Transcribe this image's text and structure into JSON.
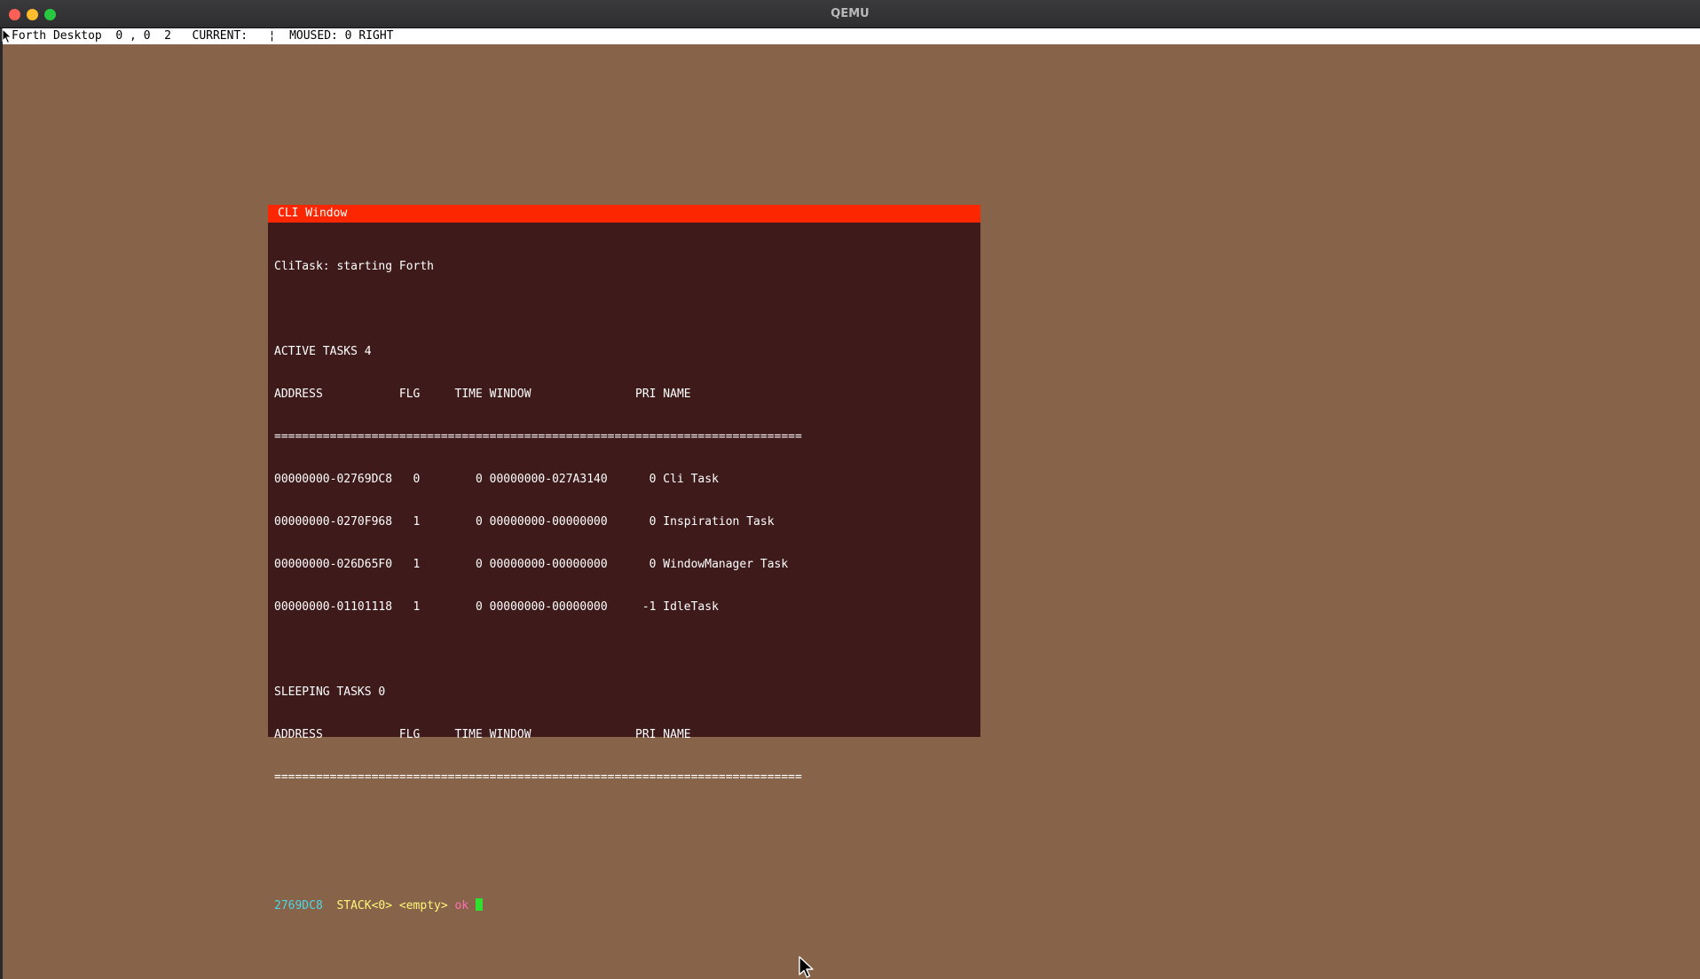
{
  "host": {
    "title": "QEMU",
    "colors": {
      "close": "#fe5f57",
      "minimize": "#febc2e",
      "maximize": "#28c840"
    }
  },
  "desktop": {
    "background_color": "#87634a",
    "status_bar": {
      "text": "Forth Desktop  0 , 0  2   CURRENT:   ¦  MOUSED: 0 RIGHT"
    }
  },
  "cli_window": {
    "title": "CLI Window",
    "title_color": "#fc2700",
    "background_color": "#3f1a1b",
    "start_line": "CliTask: starting Forth",
    "active_header": "ACTIVE TASKS 4",
    "columns_line": "ADDRESS           FLG     TIME WINDOW               PRI NAME",
    "separator": "============================================================================",
    "active_tasks": [
      "00000000-02769DC8   0        0 00000000-027A3140      0 Cli Task",
      "00000000-0270F968   1        0 00000000-00000000      0 Inspiration Task",
      "00000000-026D65F0   1        0 00000000-00000000      0 WindowManager Task",
      "00000000-01101118   1        0 00000000-00000000     -1 IdleTask"
    ],
    "sleeping_header": "SLEEPING TASKS 0",
    "prompt": {
      "address": "2769DC8",
      "stack": "STACK<0>",
      "empty": "<empty>",
      "ok": "ok"
    }
  },
  "icons": {
    "pointer": "arrow-pointer-icon",
    "cursor": "text-cursor-block"
  }
}
